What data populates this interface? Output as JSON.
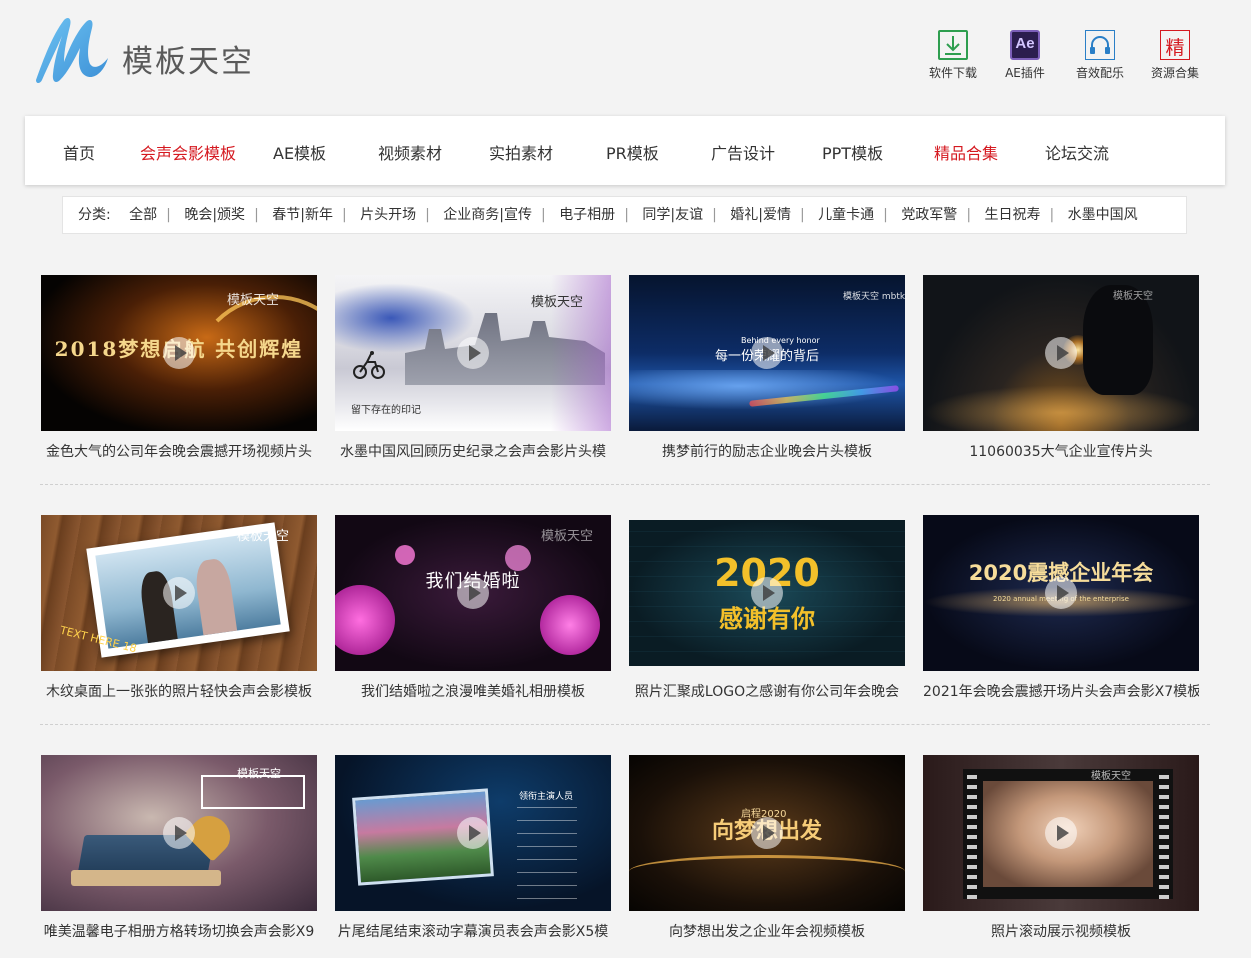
{
  "brand": {
    "name": "模板天空"
  },
  "tools": [
    {
      "label": "软件下载",
      "icon": "download-icon",
      "color": "#2e9e4f"
    },
    {
      "label": "AE插件",
      "icon": "ae-icon",
      "glyph": "Ae",
      "color": "#7c5fb8"
    },
    {
      "label": "音效配乐",
      "icon": "headphones-icon",
      "color": "#2a7fc7"
    },
    {
      "label": "资源合集",
      "icon": "jing-icon",
      "glyph": "精",
      "color": "#d51920"
    }
  ],
  "nav": [
    {
      "label": "首页"
    },
    {
      "label": "会声会影模板",
      "active": true
    },
    {
      "label": "AE模板"
    },
    {
      "label": "视频素材"
    },
    {
      "label": "实拍素材"
    },
    {
      "label": "PR模板"
    },
    {
      "label": "广告设计"
    },
    {
      "label": "PPT模板"
    },
    {
      "label": "精品合集",
      "highlight": true
    },
    {
      "label": "论坛交流"
    }
  ],
  "categories": {
    "label": "分类:",
    "items": [
      "全部",
      "晚会|颁奖",
      "春节|新年",
      "片头开场",
      "企业商务|宣传",
      "电子相册",
      "同学|友谊",
      "婚礼|爱情",
      "儿童卡通",
      "党政军警",
      "生日祝寿",
      "水墨中国风"
    ]
  },
  "cards": [
    {
      "title": "金色大气的公司年会晚会震撼开场视频片头",
      "thumb_text": "2018梦想启航 共创辉煌",
      "watermark": "模板天空"
    },
    {
      "title": "水墨中国风回顾历史纪录之会声会影片头模",
      "thumb_text": "留下存在的印记",
      "watermark": "模板天空"
    },
    {
      "title": "携梦前行的励志企业晚会片头模板",
      "thumb_text": "每一份荣耀的背后",
      "thumb_sub": "Behind every honor",
      "watermark": "模板天空 mbtk.com"
    },
    {
      "title": "11060035大气企业宣传片头",
      "thumb_text": "",
      "watermark": "模板天空"
    },
    {
      "title": "木纹桌面上一张张的照片轻快会声会影模板",
      "thumb_text": "TEXT HERE 18",
      "watermark": "模板天空"
    },
    {
      "title": "我们结婚啦之浪漫唯美婚礼相册模板",
      "thumb_text": "我们结婚啦",
      "watermark": "模板天空"
    },
    {
      "title": "照片汇聚成LOGO之感谢有你公司年会晚会",
      "thumb_text": "2020",
      "thumb_sub": "感谢有你",
      "watermark": ""
    },
    {
      "title": "2021年会晚会震撼开场片头会声会影X7模板",
      "thumb_text": "2020震撼企业年会",
      "thumb_sub": "2020 annual meeting of the enterprise",
      "watermark": ""
    },
    {
      "title": "唯美温馨电子相册方格转场切换会声会影X9",
      "thumb_text": "",
      "watermark": "模板天空"
    },
    {
      "title": "片尾结尾结束滚动字幕演员表会声会影X5模",
      "thumb_text": "领衔主演人员",
      "watermark": ""
    },
    {
      "title": "向梦想出发之企业年会视频模板",
      "thumb_text": "向梦想出发",
      "thumb_sub": "启程2020",
      "watermark": ""
    },
    {
      "title": "照片滚动展示视频模板",
      "thumb_text": "",
      "watermark": "模板天空"
    }
  ],
  "colors": {
    "accent": "#d51920",
    "logo_blue": "#4aa3df",
    "background": "#f3f3f3"
  }
}
